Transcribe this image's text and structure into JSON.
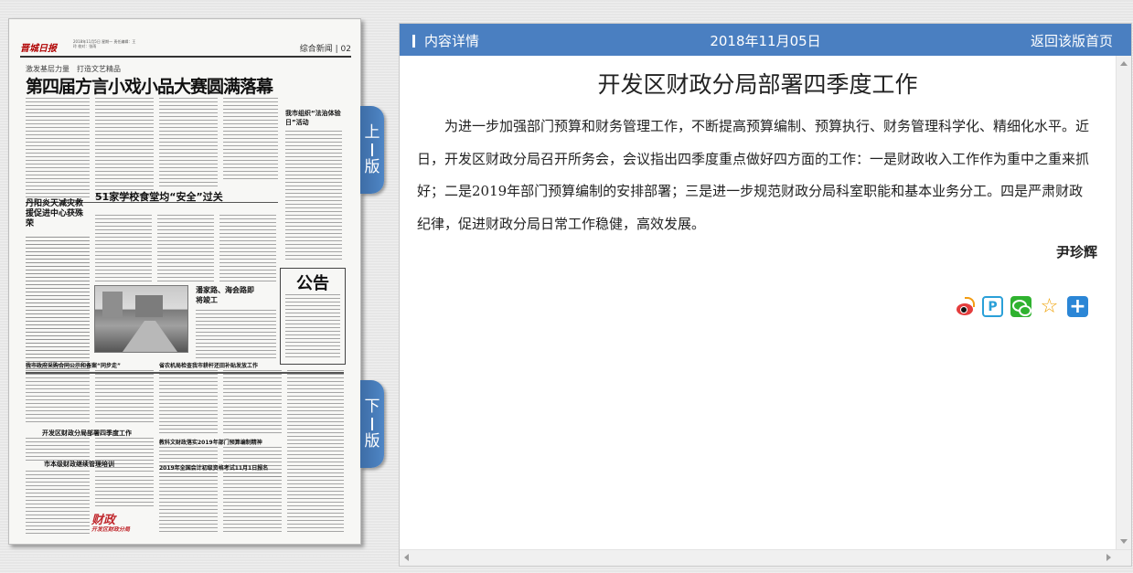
{
  "newspaper": {
    "masthead": "晋城日报",
    "issue_line": "2018年11月5日 星期一 责任编辑：王玲 校对：张雨",
    "section": "综合新闻 | 02",
    "kicker": "激发基层力量　打造文艺精品",
    "main_headline": "第四届方言小戏小品大赛圆满落幕",
    "headline_left": "丹阳炎天减灾救援促进中心获殊荣",
    "headline_food": "51家学校食堂均“安全”过关",
    "headline_road": "潘家路、海会路即将竣工",
    "headline_law": "我市组织“法治体验日”活动",
    "notice": "公告",
    "headline_procure": "我市政府采购合同公示和备案“同步走”",
    "headline_farm": "省农机局检查我市耕杆还田补贴发放工作",
    "headline_budget": "开发区财政分局部署四季度工作",
    "headline_edu": "教科文财政落实2019年部门预算编制精神",
    "headline_train": "市本级财政继续管理培训",
    "headline_exam": "2019年全国会计初级资格考试11月1日报名",
    "ad_brand": "财政",
    "ad_sub": "开发区财政分局"
  },
  "nav": {
    "prev_chars": [
      "上",
      "版"
    ],
    "next_chars": [
      "下",
      "版"
    ]
  },
  "toolbar": {
    "title": "内容详情",
    "date": "2018年11月05日",
    "home_link": "返回该版首页"
  },
  "article": {
    "title": "开发区财政分局部署四季度工作",
    "body": "为进一步加强部门预算和财务管理工作，不断提高预算编制、预算执行、财务管理科学化、精细化水平。近日，开发区财政分局召开所务会，会议指出四季度重点做好四方面的工作：一是财政收入工作作为重中之重来抓好；二是2019年部门预算编制的安排部署；三是进一步规范财政分局科室职能和基本业务分工。四是严肃财政纪律，促进财政分局日常工作稳健，高效发展。",
    "author": "尹珍辉"
  },
  "share": {
    "icons": [
      "weibo-icon",
      "tencent-weibo-icon",
      "wechat-icon",
      "qzone-star-icon",
      "more-share-icon"
    ],
    "weibo_color": "#e43d3d",
    "wechat_color": "#2fb22f",
    "star_color": "#f0a30a",
    "plus_color": "#2b86d6"
  },
  "colors": {
    "accent": "#4a7fc1",
    "tab": "#4f86c6"
  }
}
